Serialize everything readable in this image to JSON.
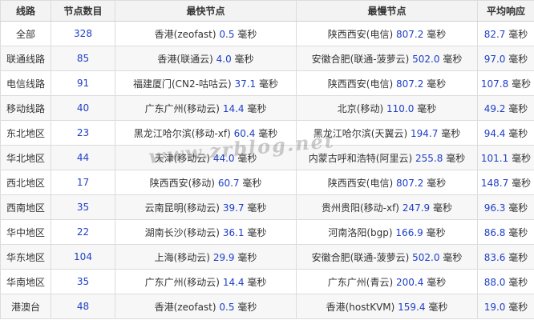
{
  "headers": {
    "route": "线路",
    "node_count": "节点数目",
    "fastest": "最快节点",
    "slowest": "最慢节点",
    "avg": "平均响应"
  },
  "unit": "毫秒",
  "rows": [
    {
      "route": "全部",
      "count": "328",
      "fast_loc": "香港(zeofast)",
      "fast_val": "0.5",
      "slow_loc": "陕西西安(电信)",
      "slow_val": "807.2",
      "avg": "82.7"
    },
    {
      "route": "联通线路",
      "count": "85",
      "fast_loc": "香港(联通云)",
      "fast_val": "4.0",
      "slow_loc": "安徽合肥(联通-菠萝云)",
      "slow_val": "502.0",
      "avg": "97.0"
    },
    {
      "route": "电信线路",
      "count": "91",
      "fast_loc": "福建厦门(CN2-咕咕云)",
      "fast_val": "37.1",
      "slow_loc": "陕西西安(电信)",
      "slow_val": "807.2",
      "avg": "107.8"
    },
    {
      "route": "移动线路",
      "count": "40",
      "fast_loc": "广东广州(移动云)",
      "fast_val": "14.4",
      "slow_loc": "北京(移动)",
      "slow_val": "110.0",
      "avg": "49.2"
    },
    {
      "route": "东北地区",
      "count": "23",
      "fast_loc": "黑龙江哈尔滨(移动-xf)",
      "fast_val": "60.4",
      "slow_loc": "黑龙江哈尔滨(天翼云)",
      "slow_val": "194.7",
      "avg": "94.4"
    },
    {
      "route": "华北地区",
      "count": "44",
      "fast_loc": "天津(移动云)",
      "fast_val": "44.0",
      "slow_loc": "内蒙古呼和浩特(阿里云)",
      "slow_val": "255.8",
      "avg": "101.1"
    },
    {
      "route": "西北地区",
      "count": "17",
      "fast_loc": "陕西西安(移动)",
      "fast_val": "60.7",
      "slow_loc": "陕西西安(电信)",
      "slow_val": "807.2",
      "avg": "148.7"
    },
    {
      "route": "西南地区",
      "count": "35",
      "fast_loc": "云南昆明(移动云)",
      "fast_val": "39.7",
      "slow_loc": "贵州贵阳(移动-xf)",
      "slow_val": "247.9",
      "avg": "96.3"
    },
    {
      "route": "华中地区",
      "count": "22",
      "fast_loc": "湖南长沙(移动云)",
      "fast_val": "36.1",
      "slow_loc": "河南洛阳(bgp)",
      "slow_val": "166.9",
      "avg": "86.8"
    },
    {
      "route": "华东地区",
      "count": "104",
      "fast_loc": "上海(移动云)",
      "fast_val": "29.9",
      "slow_loc": "安徽合肥(联通-菠萝云)",
      "slow_val": "502.0",
      "avg": "83.6"
    },
    {
      "route": "华南地区",
      "count": "35",
      "fast_loc": "广东广州(移动云)",
      "fast_val": "14.4",
      "slow_loc": "广东广州(青云)",
      "slow_val": "200.4",
      "avg": "88.0"
    },
    {
      "route": "港澳台",
      "count": "48",
      "fast_loc": "香港(zeofast)",
      "fast_val": "0.5",
      "slow_loc": "香港(hostKVM)",
      "slow_val": "159.4",
      "avg": "19.0"
    }
  ],
  "watermark": "www.zrblog.net",
  "colors": {
    "value_blue": "#1e3fc6",
    "header_bg": "#f3f3f3",
    "border": "#dcdcdc"
  }
}
